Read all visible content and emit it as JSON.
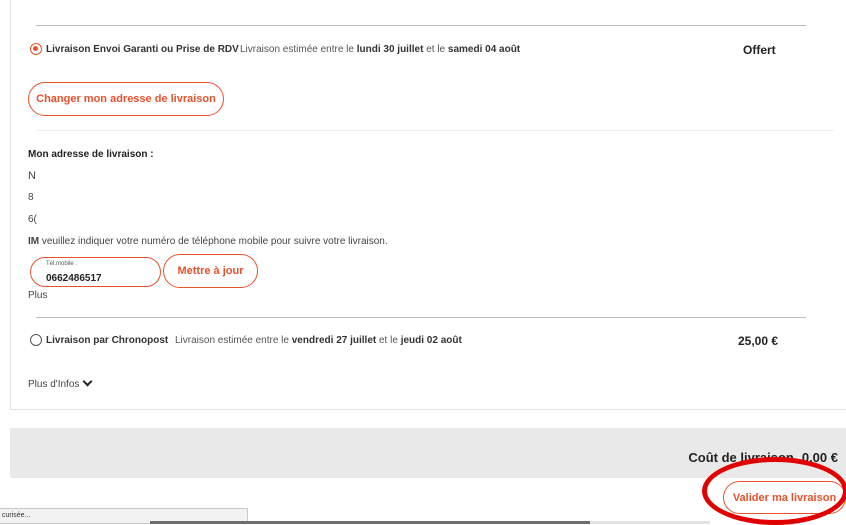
{
  "options": [
    {
      "name": "Livraison Envoi Garanti ou Prise de RDV",
      "est_prefix": "Livraison estimée entre le",
      "date_from": "lundi 30 juillet",
      "est_mid": "et le",
      "date_to": "samedi 04 août",
      "price": "Offert",
      "selected": true
    },
    {
      "name": "Livraison par Chronopost",
      "est_prefix": "Livraison estimée entre le",
      "date_from": "vendredi 27 juillet",
      "est_mid": "et le",
      "date_to": "jeudi 02 août",
      "price": "25,00 €",
      "selected": false
    }
  ],
  "change_address_label": "Changer mon adresse de livraison",
  "address": {
    "title": "Mon adresse de livraison :",
    "line1": "N",
    "line2": "8",
    "line3": "6("
  },
  "important": {
    "prefix": "IM",
    "text": "veuillez indiquer votre numéro de téléphone mobile pour suivre votre livraison."
  },
  "phone": {
    "label": "Tél.mobile :",
    "value": "0662486517",
    "update_label": "Mettre à jour"
  },
  "more_info_partial": "Plus",
  "more_info_label": "Plus d'Infos",
  "footer": {
    "cost_label": "Coût de livraison",
    "cost_value": "0,00 €",
    "validate_label": "Valider ma livraison"
  },
  "status_text": "curisée...",
  "colors": {
    "accent": "#e8512d",
    "highlight": "#e00000"
  }
}
